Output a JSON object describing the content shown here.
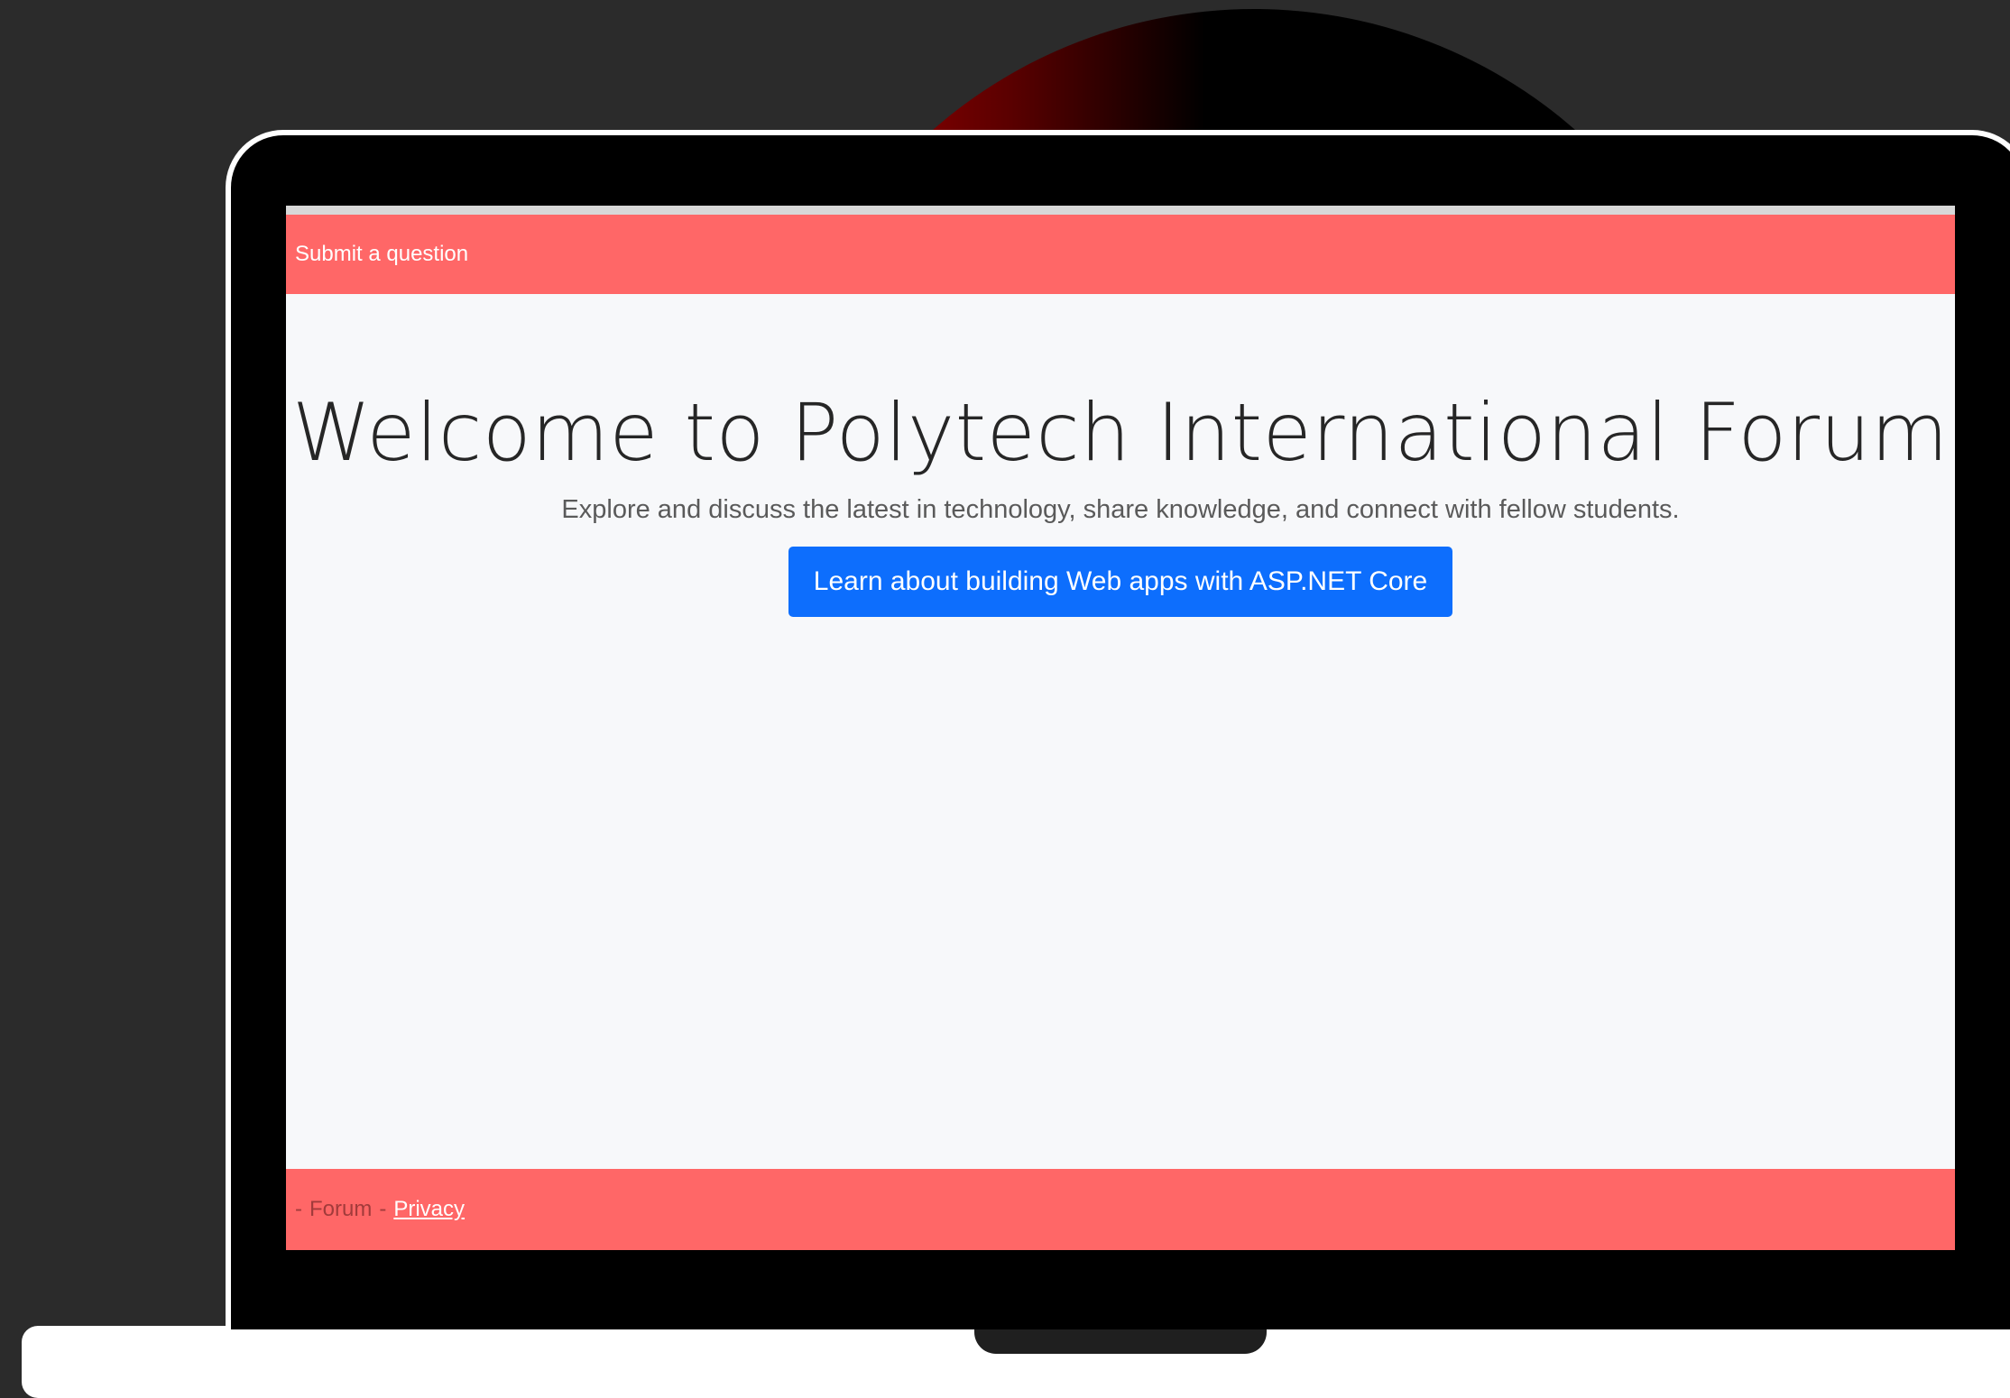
{
  "nav": {
    "submit_link": "Submit a question"
  },
  "hero": {
    "title": "Welcome to Polytech International Forum",
    "subtitle": "Explore and discuss the latest in technology, share knowledge, and connect with fellow students.",
    "cta_label": "Learn about building Web apps with ASP.NET Core"
  },
  "footer": {
    "leading_dash": "-",
    "forum_label": "Forum",
    "separator": "-",
    "privacy_link": "Privacy"
  },
  "colors": {
    "header_footer_bg": "#ff6767",
    "page_bg": "#f7f8fa",
    "button_bg": "#0d6efd",
    "outer_bg": "#2b2b2b"
  }
}
